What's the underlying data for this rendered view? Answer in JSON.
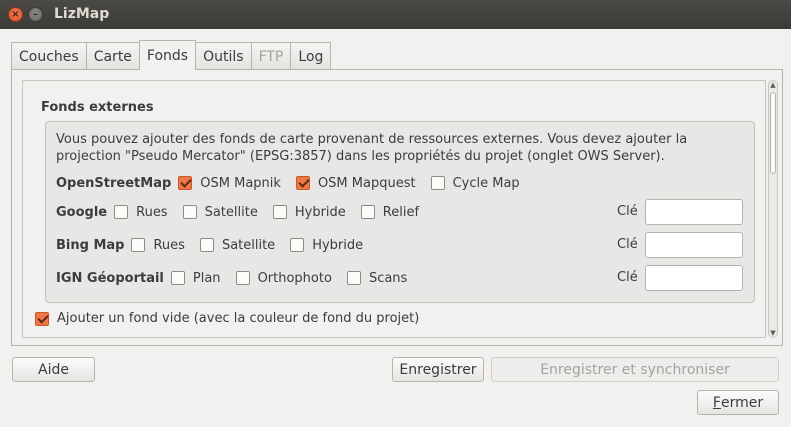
{
  "window": {
    "title": "LizMap",
    "close_glyph": "×",
    "minimize_glyph": "–"
  },
  "tabs": [
    {
      "label": "Couches",
      "state": "normal"
    },
    {
      "label": "Carte",
      "state": "normal"
    },
    {
      "label": "Fonds",
      "state": "active"
    },
    {
      "label": "Outils",
      "state": "normal"
    },
    {
      "label": "FTP",
      "state": "disabled"
    },
    {
      "label": "Log",
      "state": "normal"
    }
  ],
  "fonds": {
    "group_title": "Fonds externes",
    "description": "Vous pouvez ajouter des fonds de carte provenant de ressources externes. Vous devez ajouter la projection \"Pseudo Mercator\" (EPSG:3857) dans les propriétés du projet (onglet OWS Server).",
    "osm": {
      "label": "OpenStreetMap",
      "options": [
        {
          "label": "OSM Mapnik",
          "checked": true
        },
        {
          "label": "OSM Mapquest",
          "checked": true
        },
        {
          "label": "Cycle Map",
          "checked": false
        }
      ]
    },
    "google": {
      "label": "Google",
      "options": [
        {
          "label": "Rues",
          "checked": false
        },
        {
          "label": "Satellite",
          "checked": false
        },
        {
          "label": "Hybride",
          "checked": false
        },
        {
          "label": "Relief",
          "checked": false
        }
      ],
      "key_label": "Clé",
      "key_value": ""
    },
    "bing": {
      "label": "Bing Map",
      "options": [
        {
          "label": "Rues",
          "checked": false
        },
        {
          "label": "Satellite",
          "checked": false
        },
        {
          "label": "Hybride",
          "checked": false
        }
      ],
      "key_label": "Clé",
      "key_value": ""
    },
    "ign": {
      "label": "IGN Géoportail",
      "options": [
        {
          "label": "Plan",
          "checked": false
        },
        {
          "label": "Orthophoto",
          "checked": false
        },
        {
          "label": "Scans",
          "checked": false
        }
      ],
      "key_label": "Clé",
      "key_value": ""
    },
    "empty_background": {
      "label": "Ajouter un fond vide (avec la couleur de fond du projet)",
      "checked": true
    }
  },
  "scrollbar": {
    "up_glyph": "▲",
    "down_glyph": "▼"
  },
  "buttons": {
    "help": "Aide",
    "save": "Enregistrer",
    "save_sync": "Enregistrer et synchroniser",
    "close_mnemonic": "F",
    "close_rest": "ermer"
  },
  "colors": {
    "accent": "#ee7748",
    "titlebar": "#3b3a36"
  }
}
